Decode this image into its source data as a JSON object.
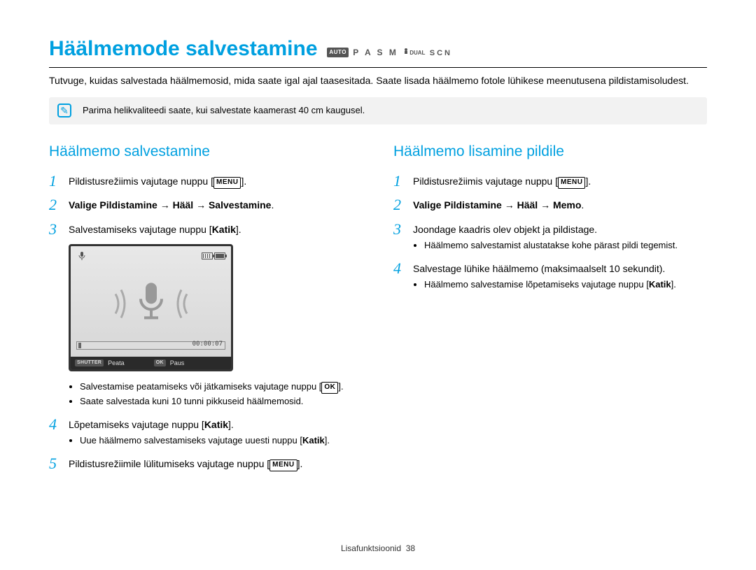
{
  "title": "Häälmemode salvestamine",
  "mode_strip": {
    "auto": "AUTO",
    "letters": "P A S M",
    "dual": "DUAL",
    "scn": "SCN"
  },
  "intro": "Tutvuge, kuidas salvestada häälmemosid, mida saate igal ajal taasesitada. Saate lisada häälmemo fotole lühikese meenutusena pildistamisoludest.",
  "tip": "Parima helikvaliteedi saate, kui salvestate kaamerast 40 cm kaugusel.",
  "left": {
    "heading": "Häälmemo salvestamine",
    "steps": [
      {
        "num": "1",
        "pre": "Pildistusrežiimis vajutage nuppu ",
        "btn": "MENU",
        "post": "."
      },
      {
        "num": "2",
        "bold": "Valige Pildistamine → Hääl → Salvestamine",
        "post_plain": "."
      },
      {
        "num": "3",
        "pre": "Salvestamiseks vajutage nuppu [",
        "bold_inline": "Katik",
        "post": "]."
      }
    ],
    "camera": {
      "time": "00:00:07",
      "stop_label": "SHUTTER",
      "stop_text": "Peata",
      "ok_label": "OK",
      "ok_text": "Paus"
    },
    "step3_bullets": [
      {
        "pre": "Salvestamise peatamiseks või jätkamiseks vajutage nuppu [",
        "btn": "OK",
        "post": "]."
      },
      {
        "plain": "Saate salvestada kuni 10 tunni pikkuseid häälmemosid."
      }
    ],
    "step4": {
      "num": "4",
      "pre": "Lõpetamiseks vajutage nuppu [",
      "bold_inline": "Katik",
      "post": "].",
      "bullets": [
        {
          "pre": "Uue häälmemo salvestamiseks vajutage uuesti nuppu [",
          "bold": "Katik",
          "post": "]."
        }
      ]
    },
    "step5": {
      "num": "5",
      "pre": "Pildistusrežiimile lülitumiseks vajutage nuppu ",
      "btn": "MENU",
      "post": "."
    }
  },
  "right": {
    "heading": "Häälmemo lisamine pildile",
    "steps": [
      {
        "num": "1",
        "pre": "Pildistusrežiimis vajutage nuppu ",
        "btn": "MENU",
        "post": "."
      },
      {
        "num": "2",
        "bold": "Valige Pildistamine → Hääl → Memo",
        "post_plain": "."
      },
      {
        "num": "3",
        "plain": "Joondage kaadris olev objekt ja pildistage.",
        "bullets": [
          {
            "plain": "Häälmemo salvestamist alustatakse kohe pärast pildi tegemist."
          }
        ]
      },
      {
        "num": "4",
        "plain": "Salvestage lühike häälmemo (maksimaalselt 10 sekundit).",
        "bullets": [
          {
            "pre": "Häälmemo salvestamise lõpetamiseks vajutage nuppu [",
            "bold": "Katik",
            "post": "]."
          }
        ]
      }
    ]
  },
  "footer": {
    "section": "Lisafunktsioonid",
    "page": "38"
  }
}
